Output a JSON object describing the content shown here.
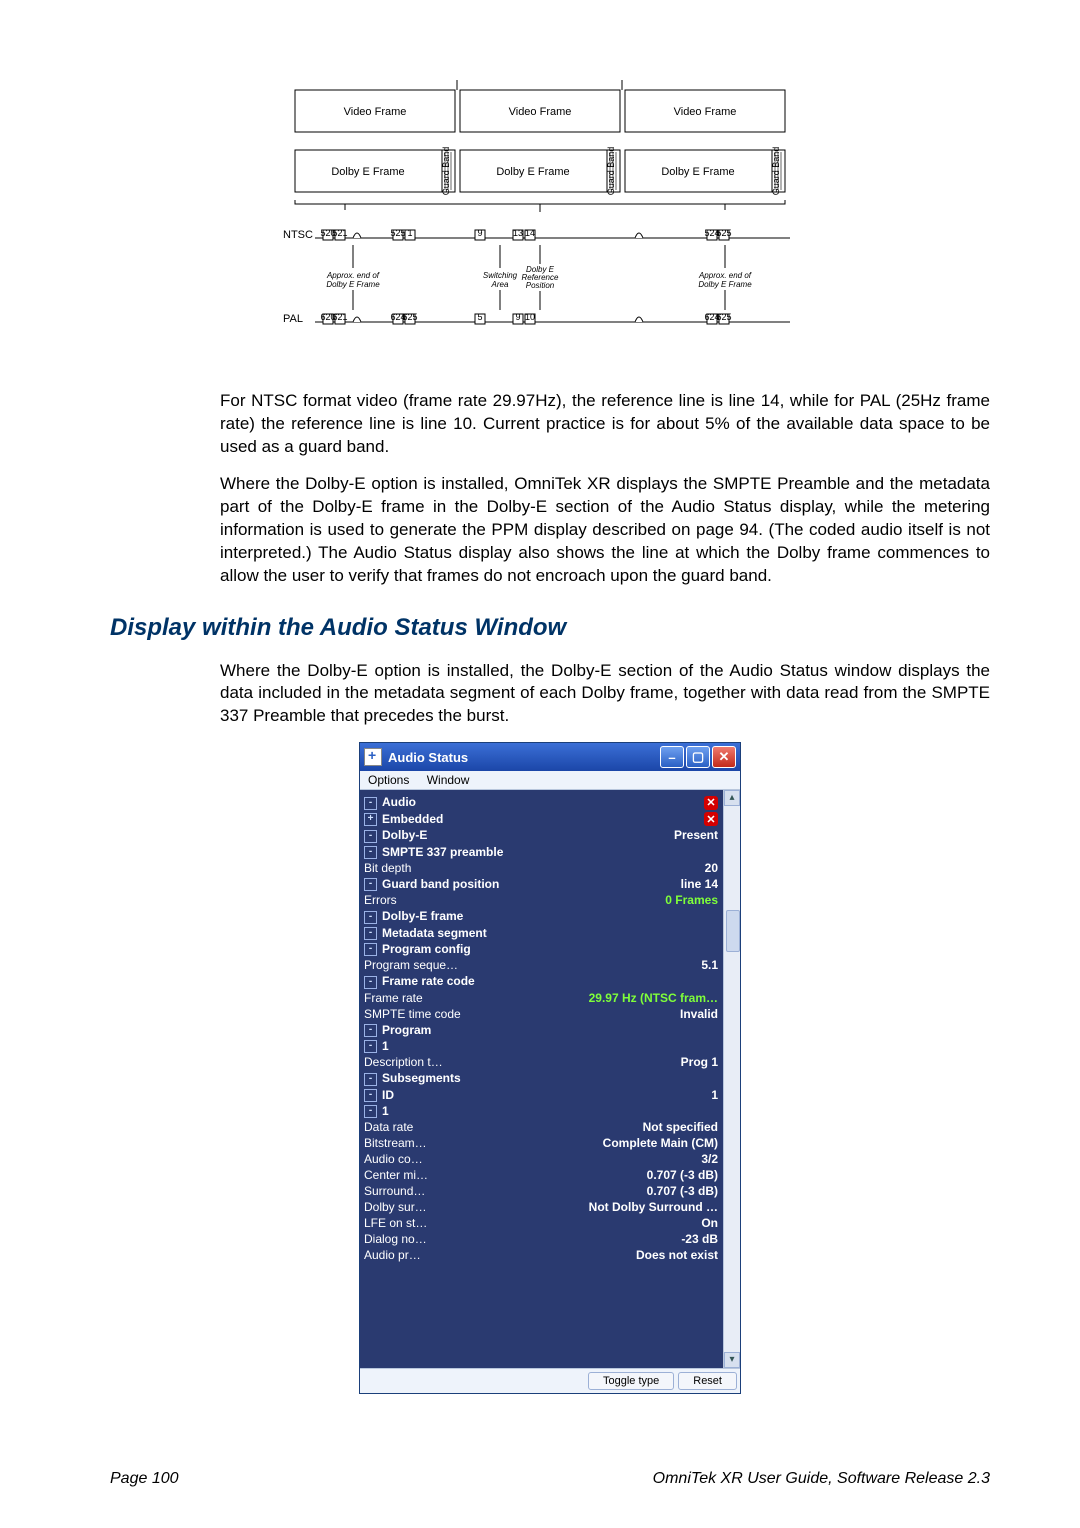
{
  "diagram": {
    "video_frame": "Video Frame",
    "dolby_e_frame": "Dolby E Frame",
    "guard_band": "Guard Band",
    "ntsc": "NTSC",
    "pal": "PAL",
    "approx_end": "Approx. end of\nDolby E Frame",
    "switching_area": "Switching\nArea",
    "ref_pos": "Dolby E\nReference\nPosition",
    "ntsc_ticks": [
      "520",
      "521",
      "",
      "525",
      "1",
      "",
      "9",
      "",
      "13",
      "14",
      "",
      "",
      "",
      "524",
      "525"
    ],
    "pal_ticks": [
      "620",
      "621",
      "",
      "624",
      "625",
      "",
      "5",
      "",
      "9",
      "10",
      "",
      "",
      "",
      "624",
      "625"
    ]
  },
  "paragraphs": {
    "p1": "For NTSC format video (frame rate 29.97Hz), the reference line is line 14, while for PAL (25Hz frame rate) the reference line is line 10. Current practice is for about 5% of the available data space to be used as a guard band.",
    "p2": "Where the Dolby-E option is installed, OmniTek XR displays the SMPTE Preamble and the metadata part of the Dolby-E frame in the Dolby-E section of the Audio Status display, while the metering information is used to generate the PPM display described on page 94. (The coded audio itself is not interpreted.) The Audio Status display also shows the line at which the Dolby frame commences to allow the user to verify that frames do not encroach upon the guard band.",
    "heading": "Display within the Audio Status Window",
    "p3": "Where the Dolby-E option is installed, the Dolby-E section of the Audio Status window displays the data included in the metadata segment of each Dolby frame, together with data read from the SMPTE 337 Preamble that precedes the burst."
  },
  "window": {
    "title": "Audio Status",
    "menu": {
      "options": "Options",
      "window": "Window"
    },
    "buttons": {
      "toggle": "Toggle type",
      "reset": "Reset"
    }
  },
  "tree": {
    "audio": "Audio",
    "embedded": "Embedded",
    "dolbye": {
      "label": "Dolby-E",
      "value": "Present"
    },
    "smpte_pre": "SMPTE 337 preamble",
    "bit_depth": {
      "label": "Bit depth",
      "value": "20"
    },
    "guard_band": {
      "label": "Guard band position",
      "value": "line 14"
    },
    "errors": {
      "label": "Errors",
      "value": "0 Frames"
    },
    "dolbye_frame": "Dolby-E frame",
    "meta_seg": "Metadata segment",
    "prog_config": "Program config",
    "prog_seq": {
      "label": "Program seque…",
      "value": "5.1"
    },
    "frame_rate_code": "Frame rate code",
    "frame_rate": {
      "label": "Frame rate",
      "value": "29.97 Hz (NTSC fram…"
    },
    "smpte_tc": {
      "label": "SMPTE time code",
      "value": "Invalid"
    },
    "program": "Program",
    "prog1": "1",
    "desc": {
      "label": "Description t…",
      "value": "Prog 1"
    },
    "subsegments": "Subsegments",
    "id": {
      "label": "ID",
      "value": "1"
    },
    "sub1": "1",
    "data_rate": {
      "label": "Data rate",
      "value": "Not specified"
    },
    "bitstream": {
      "label": "Bitstream…",
      "value": "Complete Main (CM)"
    },
    "audio_co": {
      "label": "Audio co…",
      "value": "3/2"
    },
    "center_mi": {
      "label": "Center mi…",
      "value": "0.707 (-3 dB)"
    },
    "surround": {
      "label": "Surround…",
      "value": "0.707 (-3 dB)"
    },
    "dolby_sur": {
      "label": "Dolby sur…",
      "value": "Not Dolby Surround …"
    },
    "lfe": {
      "label": "LFE on st…",
      "value": "On"
    },
    "dialog": {
      "label": "Dialog no…",
      "value": "-23 dB"
    },
    "audio_pr": {
      "label": "Audio pr…",
      "value": "Does not exist"
    }
  },
  "footer": {
    "left": "Page 100",
    "right": "OmniTek XR User Guide, Software Release 2.3"
  }
}
